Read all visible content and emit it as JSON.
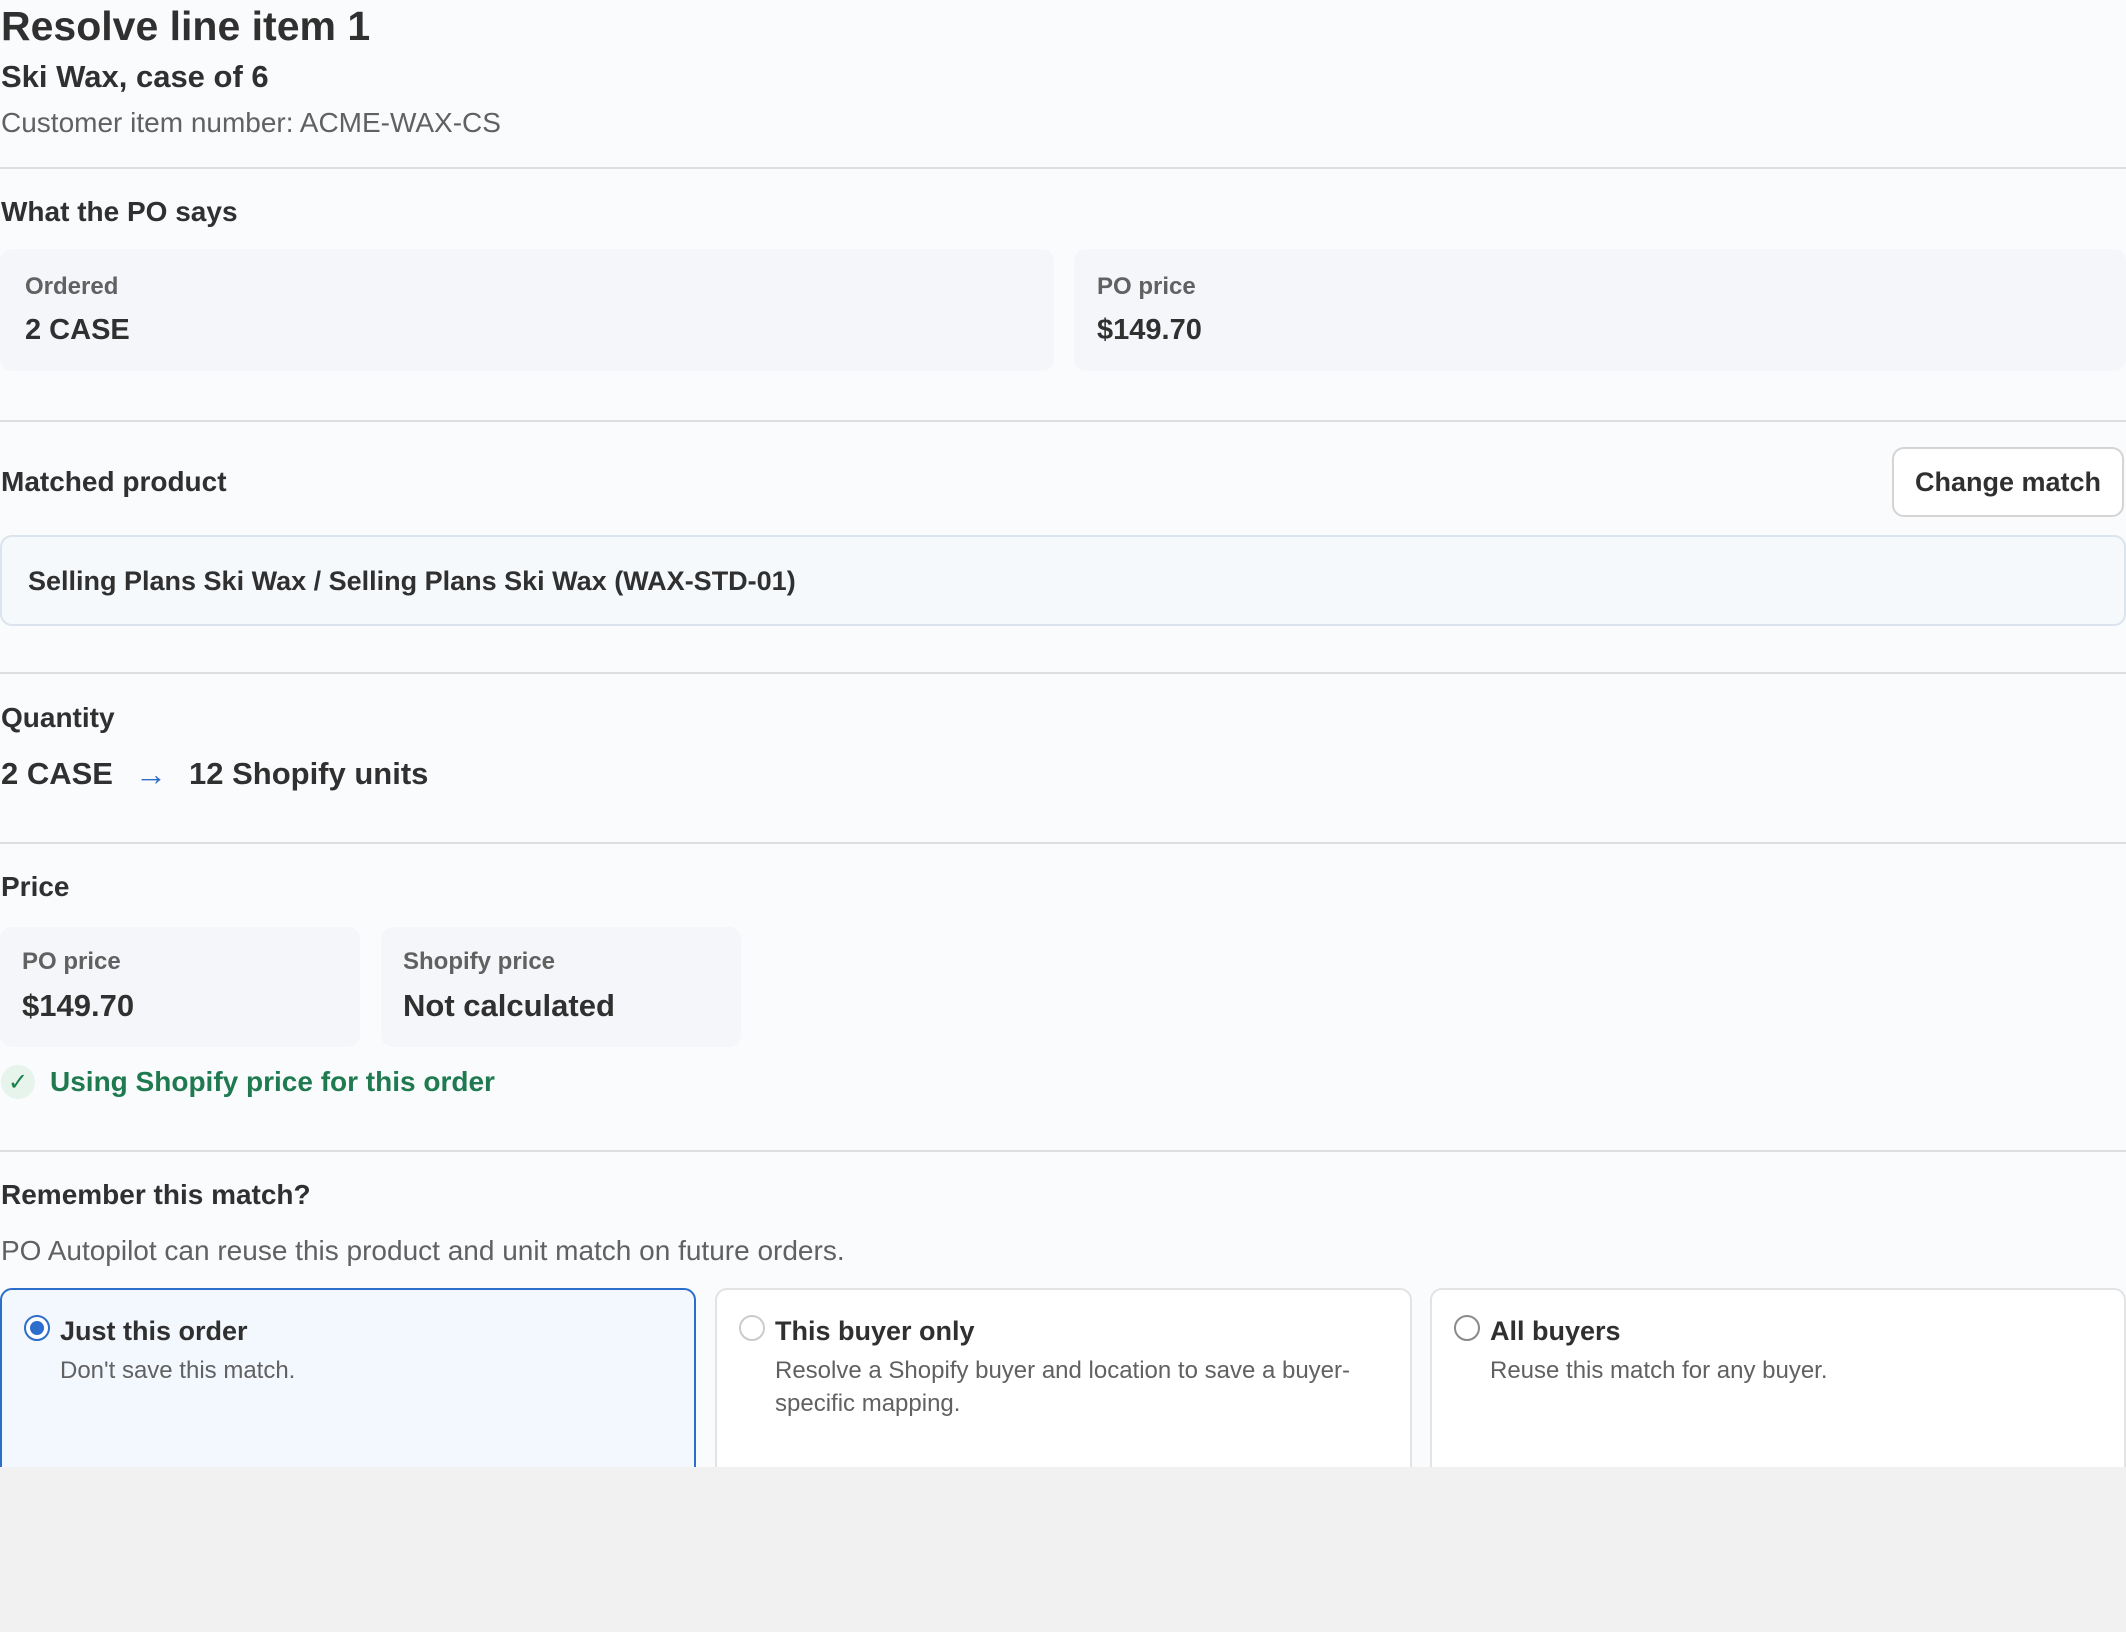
{
  "header": {
    "title": "Resolve line item 1",
    "subtitle": "Ski Wax, case of 6",
    "customer_item": "Customer item number: ACME-WAX-CS"
  },
  "po_section": {
    "heading": "What the PO says",
    "ordered_label": "Ordered",
    "ordered_value": "2 CASE",
    "price_label": "PO price",
    "price_value": "$149.70"
  },
  "matched_section": {
    "heading": "Matched product",
    "change_button": "Change match",
    "product": "Selling Plans Ski Wax / Selling Plans Ski Wax (WAX-STD-01)"
  },
  "quantity_section": {
    "heading": "Quantity",
    "from": "2 CASE",
    "arrow": "→",
    "to": "12 Shopify units"
  },
  "price_section": {
    "heading": "Price",
    "po_price_label": "PO price",
    "po_price_value": "$149.70",
    "shopify_price_label": "Shopify price",
    "shopify_price_value": "Not calculated",
    "status_icon": "check-icon",
    "status_text": "Using Shopify price for this order",
    "status_color": "#1f7a50"
  },
  "remember_section": {
    "heading": "Remember this match?",
    "description": "PO Autopilot can reuse this product and unit match on future orders.",
    "selected": "just_this_order",
    "options": [
      {
        "id": "just_this_order",
        "title": "Just this order",
        "description": "Don't save this match."
      },
      {
        "id": "this_buyer_only",
        "title": "This buyer only",
        "description": "Resolve a Shopify buyer and location to save a buyer-specific mapping."
      },
      {
        "id": "all_buyers",
        "title": "All buyers",
        "description": "Reuse this match for any buyer."
      }
    ]
  },
  "colors": {
    "accent": "#2c6ecb",
    "success": "#1f7a50",
    "panel_bg": "#f9fbfd"
  }
}
